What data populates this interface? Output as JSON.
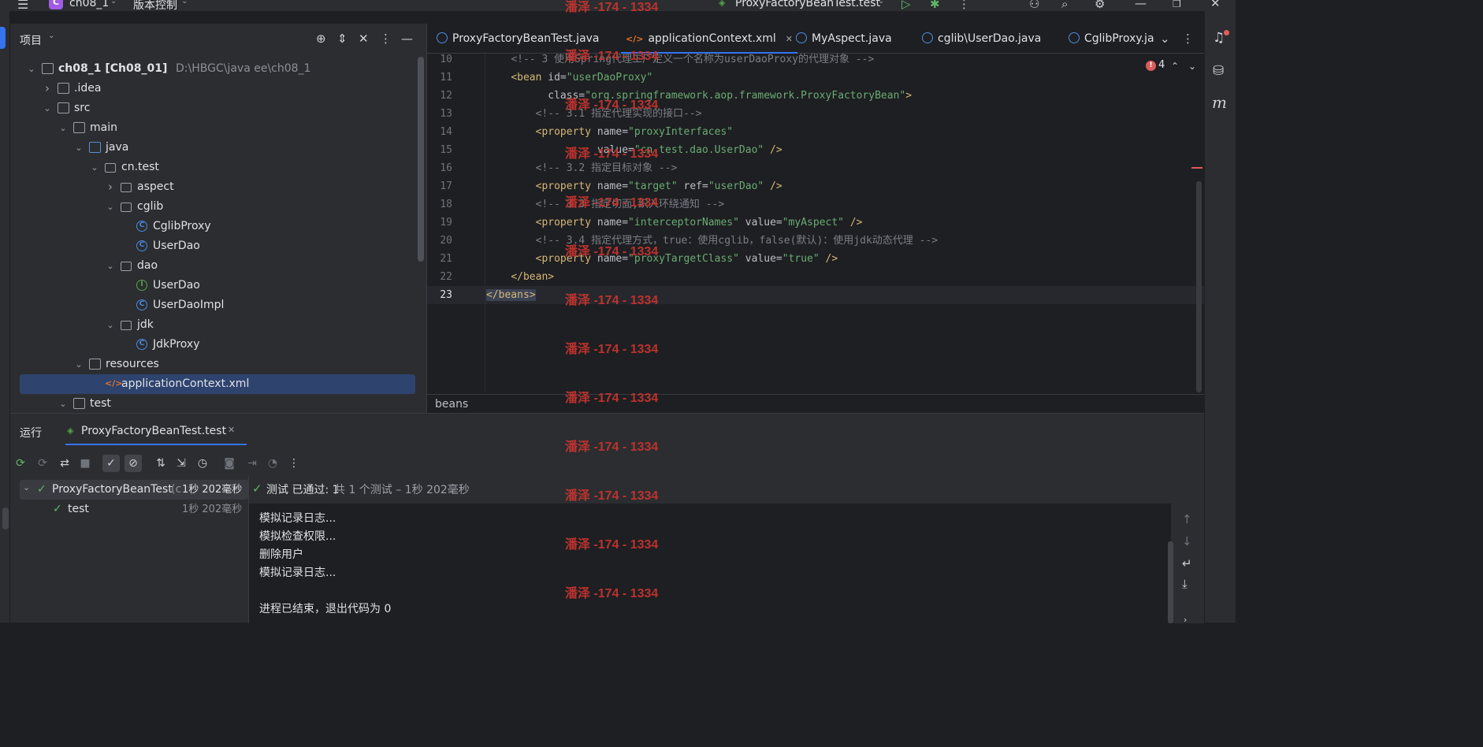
{
  "titlebar": {
    "project_badge": "C",
    "project_name": "ch08_1",
    "vcs_label": "版本控制",
    "run_config": "ProxyFactoryBeanTest.test"
  },
  "project_panel": {
    "title": "项目",
    "tree": [
      {
        "label": "ch08_1 [Ch08_01]",
        "path": "D:\\HBGC\\java ee\\ch08_1",
        "depth": 0,
        "arrow": "down",
        "icon": "folder"
      },
      {
        "label": ".idea",
        "depth": 1,
        "arrow": "right",
        "icon": "folder"
      },
      {
        "label": "src",
        "depth": 1,
        "arrow": "down",
        "icon": "folder"
      },
      {
        "label": "main",
        "depth": 2,
        "arrow": "down",
        "icon": "folder"
      },
      {
        "label": "java",
        "depth": 3,
        "arrow": "down",
        "icon": "folder-blue"
      },
      {
        "label": "cn.test",
        "depth": 4,
        "arrow": "down",
        "icon": "package"
      },
      {
        "label": "aspect",
        "depth": 5,
        "arrow": "right",
        "icon": "package"
      },
      {
        "label": "cglib",
        "depth": 5,
        "arrow": "down",
        "icon": "package"
      },
      {
        "label": "CglibProxy",
        "depth": 6,
        "arrow": "",
        "icon": "class"
      },
      {
        "label": "UserDao",
        "depth": 6,
        "arrow": "",
        "icon": "class"
      },
      {
        "label": "dao",
        "depth": 5,
        "arrow": "down",
        "icon": "package"
      },
      {
        "label": "UserDao",
        "depth": 6,
        "arrow": "",
        "icon": "interface"
      },
      {
        "label": "UserDaoImpl",
        "depth": 6,
        "arrow": "",
        "icon": "class"
      },
      {
        "label": "jdk",
        "depth": 5,
        "arrow": "down",
        "icon": "package"
      },
      {
        "label": "JdkProxy",
        "depth": 6,
        "arrow": "",
        "icon": "class"
      },
      {
        "label": "resources",
        "depth": 3,
        "arrow": "down",
        "icon": "folder"
      },
      {
        "label": "applicationContext.xml",
        "depth": 4,
        "arrow": "",
        "icon": "xml",
        "selected": true
      },
      {
        "label": "test",
        "depth": 2,
        "arrow": "down",
        "icon": "folder"
      }
    ]
  },
  "editor": {
    "tabs": [
      {
        "label": "ProxyFactoryBeanTest.java",
        "icon": "class"
      },
      {
        "label": "applicationContext.xml",
        "icon": "xml",
        "active": true
      },
      {
        "label": "MyAspect.java",
        "icon": "class"
      },
      {
        "label": "cglib\\UserDao.java",
        "icon": "class"
      },
      {
        "label": "CglibProxy.ja",
        "icon": "class"
      }
    ],
    "problem_count": "4",
    "breadcrumb": "beans",
    "lines": [
      {
        "n": "10",
        "indent": 4,
        "parts": [
          [
            "c-com",
            "<!-- 3 使用Spring代理工厂定义一个名称为userDaoProxy的代理对象 -->"
          ]
        ]
      },
      {
        "n": "11",
        "indent": 4,
        "parts": [
          [
            "c-tag",
            "<bean "
          ],
          [
            "c-attr",
            "id="
          ],
          [
            "c-val",
            "\"userDaoProxy\""
          ]
        ]
      },
      {
        "n": "12",
        "indent": 10,
        "parts": [
          [
            "c-attr",
            "class="
          ],
          [
            "c-val",
            "\"org.springframework.aop.framework.ProxyFactoryBean\""
          ],
          [
            "c-tag",
            ">"
          ]
        ]
      },
      {
        "n": "13",
        "indent": 8,
        "parts": [
          [
            "c-com",
            "<!-- 3.1 指定代理实现的接口-->"
          ]
        ]
      },
      {
        "n": "14",
        "indent": 8,
        "parts": [
          [
            "c-tag",
            "<property "
          ],
          [
            "c-attr",
            "name="
          ],
          [
            "c-val",
            "\"proxyInterfaces\""
          ]
        ]
      },
      {
        "n": "15",
        "indent": 18,
        "parts": [
          [
            "c-attr",
            "value="
          ],
          [
            "c-val",
            "\"cn.test.dao.UserDao\""
          ],
          [
            "c-tag",
            " />"
          ]
        ]
      },
      {
        "n": "16",
        "indent": 8,
        "parts": [
          [
            "c-com",
            "<!-- 3.2 指定目标对象 -->"
          ]
        ]
      },
      {
        "n": "17",
        "indent": 8,
        "parts": [
          [
            "c-tag",
            "<property "
          ],
          [
            "c-attr",
            "name="
          ],
          [
            "c-val",
            "\"target\""
          ],
          [
            "c-attr",
            " ref="
          ],
          [
            "c-val",
            "\"userDao\""
          ],
          [
            "c-tag",
            " />"
          ]
        ]
      },
      {
        "n": "18",
        "indent": 8,
        "parts": [
          [
            "c-com",
            "<!-- 3.3 指定切面,织入环绕通知 -->"
          ]
        ]
      },
      {
        "n": "19",
        "indent": 8,
        "parts": [
          [
            "c-tag",
            "<property "
          ],
          [
            "c-attr",
            "name="
          ],
          [
            "c-val",
            "\"interceptorNames\""
          ],
          [
            "c-attr",
            " value="
          ],
          [
            "c-val",
            "\"myAspect\""
          ],
          [
            "c-tag",
            " />"
          ]
        ]
      },
      {
        "n": "20",
        "indent": 8,
        "parts": [
          [
            "c-com",
            "<!-- 3.4 指定代理方式，true：使用cglib，false(默认)：使用jdk动态代理 -->"
          ]
        ]
      },
      {
        "n": "21",
        "indent": 8,
        "parts": [
          [
            "c-tag",
            "<property "
          ],
          [
            "c-attr",
            "name="
          ],
          [
            "c-val",
            "\"proxyTargetClass\""
          ],
          [
            "c-attr",
            " value="
          ],
          [
            "c-val",
            "\"true\""
          ],
          [
            "c-tag",
            " />"
          ]
        ]
      },
      {
        "n": "22",
        "indent": 4,
        "parts": [
          [
            "c-tag",
            "</bean>"
          ]
        ]
      },
      {
        "n": "23",
        "indent": 0,
        "parts": [
          [
            "c-tag",
            "</beans>"
          ]
        ],
        "current": true
      }
    ]
  },
  "run_panel": {
    "title": "运行",
    "tab_label": "ProxyFactoryBeanTest.test",
    "tests": [
      {
        "label": "ProxyFactoryBeanTest",
        "suffix": "(c",
        "time": "1秒 202毫秒",
        "depth": 0
      },
      {
        "label": "test",
        "suffix": "",
        "time": "1秒 202毫秒",
        "depth": 1
      }
    ],
    "status_prefix": "测试 已通过: 1",
    "status_detail": "共 1 个测试 – 1秒 202毫秒",
    "output": [
      "模拟记录日志...",
      "模拟检查权限...",
      "删除用户",
      "模拟记录日志...",
      "",
      "进程已结束，退出代码为 0"
    ]
  },
  "watermark": {
    "text": "潘泽 -174 - 1334"
  },
  "colors": {
    "accent": "#3574f0",
    "success": "#5fb865",
    "watermark": "#c9342f"
  }
}
